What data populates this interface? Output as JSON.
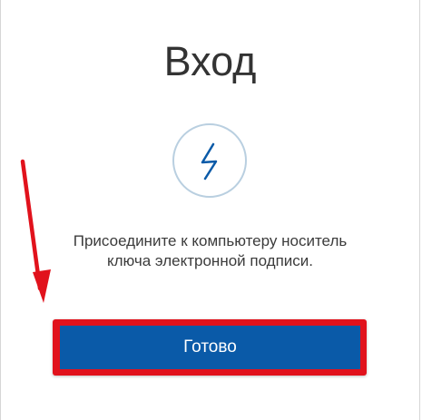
{
  "login": {
    "title": "Вход",
    "icon": "lightning-icon",
    "instruction_line1": "Присоедините к компьютеру носитель",
    "instruction_line2": "ключа электронной подписи.",
    "done_label": "Готово"
  },
  "colors": {
    "button_bg": "#0a5aa8",
    "highlight": "#e1121c",
    "icon_stroke": "#0a5aa8",
    "icon_circle": "#b9cfe0"
  }
}
